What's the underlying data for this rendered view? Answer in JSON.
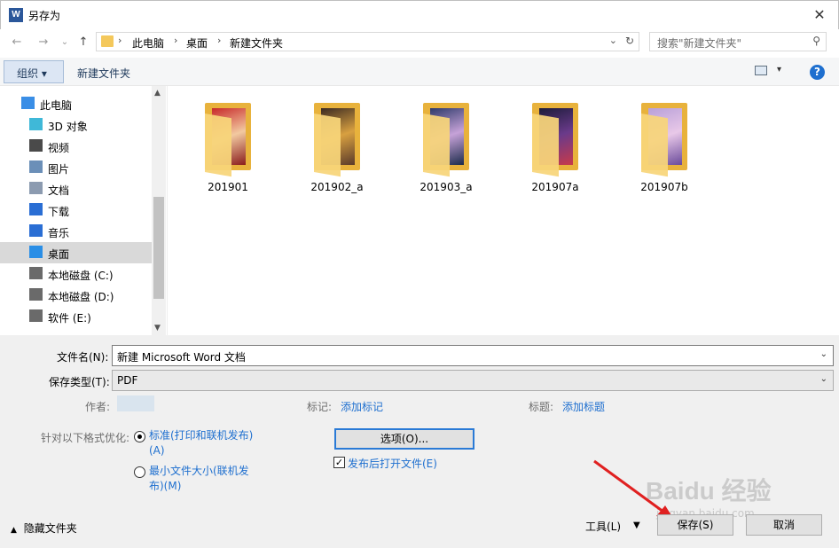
{
  "window": {
    "title": "另存为",
    "app_icon_letter": "W",
    "close_glyph": "✕"
  },
  "nav": {
    "back_glyph": "←",
    "forward_glyph": "→",
    "recent_glyph": "⌄",
    "up_glyph": "↑",
    "breadcrumbs": [
      "此电脑",
      "桌面",
      "新建文件夹"
    ],
    "separator": "›",
    "search_placeholder": "搜索\"新建文件夹\"",
    "search_glyph": "⚲",
    "refresh_glyph": "↻",
    "dropdown_glyph": "⌄"
  },
  "toolbar": {
    "organize_label": "组织 ▾",
    "new_folder_label": "新建文件夹",
    "help_glyph": "?",
    "view_drop_glyph": "▾"
  },
  "sidebar": {
    "items": [
      {
        "label": "此电脑",
        "icon": "computer-icon",
        "selected": false
      },
      {
        "label": "3D 对象",
        "icon": "cube-3d-icon",
        "selected": false
      },
      {
        "label": "视频",
        "icon": "video-icon",
        "selected": false
      },
      {
        "label": "图片",
        "icon": "picture-icon",
        "selected": false
      },
      {
        "label": "文档",
        "icon": "document-icon",
        "selected": false
      },
      {
        "label": "下载",
        "icon": "download-icon",
        "selected": false
      },
      {
        "label": "音乐",
        "icon": "music-icon",
        "selected": false
      },
      {
        "label": "桌面",
        "icon": "desktop-icon",
        "selected": true
      },
      {
        "label": "本地磁盘 (C:)",
        "icon": "drive-c-icon",
        "selected": false
      },
      {
        "label": "本地磁盘 (D:)",
        "icon": "drive-d-icon",
        "selected": false
      },
      {
        "label": "软件 (E:)",
        "icon": "drive-e-icon",
        "selected": false
      }
    ],
    "scroll_up_glyph": "▲",
    "scroll_down_glyph": "▼"
  },
  "files": [
    {
      "name": "201901",
      "colors": [
        "#c8292a",
        "#f2c9a0",
        "#8a1c1c"
      ]
    },
    {
      "name": "201902_a",
      "colors": [
        "#3a2a22",
        "#d8a040",
        "#5a3a2a"
      ]
    },
    {
      "name": "201903_a",
      "colors": [
        "#2d3a6a",
        "#c6a2d8",
        "#1a2a4a"
      ]
    },
    {
      "name": "201907a",
      "colors": [
        "#1c1c3a",
        "#6a3a8a",
        "#c83a4a"
      ]
    },
    {
      "name": "201907b",
      "colors": [
        "#b8a0d8",
        "#e8c8e8",
        "#6a4a9a"
      ]
    }
  ],
  "form": {
    "filename_label": "文件名(N):",
    "filename_value": "新建 Microsoft Word 文档",
    "filetype_label": "保存类型(T):",
    "filetype_value": "PDF",
    "author_label": "作者:",
    "tags_label": "标记:",
    "tags_link": "添加标记",
    "title_label": "标题:",
    "title_link": "添加标题",
    "optimize_label": "针对以下格式优化:",
    "radio_standard_line1": "标准(打印和联机发布)",
    "radio_standard_line2": "(A)",
    "radio_min_line1": "最小文件大小(联机发",
    "radio_min_line2": "布)(M)",
    "options_button": "选项(O)...",
    "open_after_label": "发布后打开文件(E)",
    "open_after_checked": true,
    "check_glyph": "✓",
    "combo_arrow": "⌄"
  },
  "footer": {
    "hide_folders_label": "隐藏文件夹",
    "hide_folders_glyph": "▲",
    "tools_label": "工具(L)",
    "tools_drop_glyph": "▼",
    "save_label": "保存(S)",
    "cancel_label": "取消"
  },
  "watermark": {
    "text": "Baidu 经验",
    "sub": "jingyan.baidu.com"
  }
}
